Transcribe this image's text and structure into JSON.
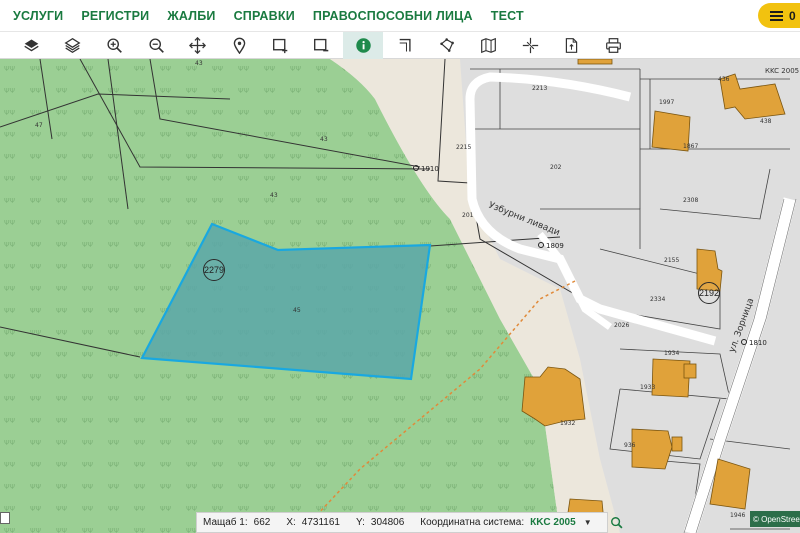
{
  "nav": {
    "items": [
      "УСЛУГИ",
      "РЕГИСТРИ",
      "ЖАЛБИ",
      "СПРАВКИ",
      "ПРАВОСПОСОБНИ ЛИЦА",
      "ТЕСТ"
    ],
    "menu_count": "0"
  },
  "toolbar": {
    "tools": [
      "layers-icon",
      "layers-stack-icon",
      "zoom-in-icon",
      "zoom-out-icon",
      "pan-icon",
      "location-pin-icon",
      "select-rect-icon",
      "deselect-rect-icon",
      "info-icon",
      "measure-corner-icon",
      "edit-shape-icon",
      "map-icon",
      "split-icon",
      "document-icon",
      "print-icon"
    ],
    "active": "info-icon"
  },
  "map": {
    "labels": {
      "road": "Узбурни ливади",
      "street": "ул. Зорница",
      "crs_corner": "КKC 2005",
      "parcel_main": "2279",
      "parcel_right": "2192",
      "pt_1910": "1910",
      "pt_1809": "1809",
      "pt_1810": "1810",
      "n43a": "43",
      "n43b": "43",
      "n43c": "43",
      "n47": "47",
      "n45": "45",
      "n2215": "2215",
      "n2213": "2213",
      "n202": "202",
      "n201": "201",
      "n2308": "2308",
      "n1997": "1997",
      "n1867": "1867",
      "n436": "436",
      "n438": "438",
      "n2155": "2155",
      "n2334": "2334",
      "n2026": "2026",
      "n1934": "1934",
      "n1933": "1933",
      "n1932": "1932",
      "n1946": "1946",
      "n936": "936"
    },
    "colors": {
      "forest": "#9bcf94",
      "selected_fill": "#5aa7a8",
      "selected_stroke": "#19a8e0",
      "building": "#e0a23a",
      "parcel_gray": "#dedede",
      "road_white": "#ffffff"
    }
  },
  "status": {
    "scale_label": "Мащаб 1:",
    "scale_value": "662",
    "x_label": "X:",
    "x_value": "4731161",
    "y_label": "Y:",
    "y_value": "304806",
    "crs_label": "Координатна система:",
    "crs_value": "КKC 2005"
  },
  "attribution": "© OpenStreetMap"
}
